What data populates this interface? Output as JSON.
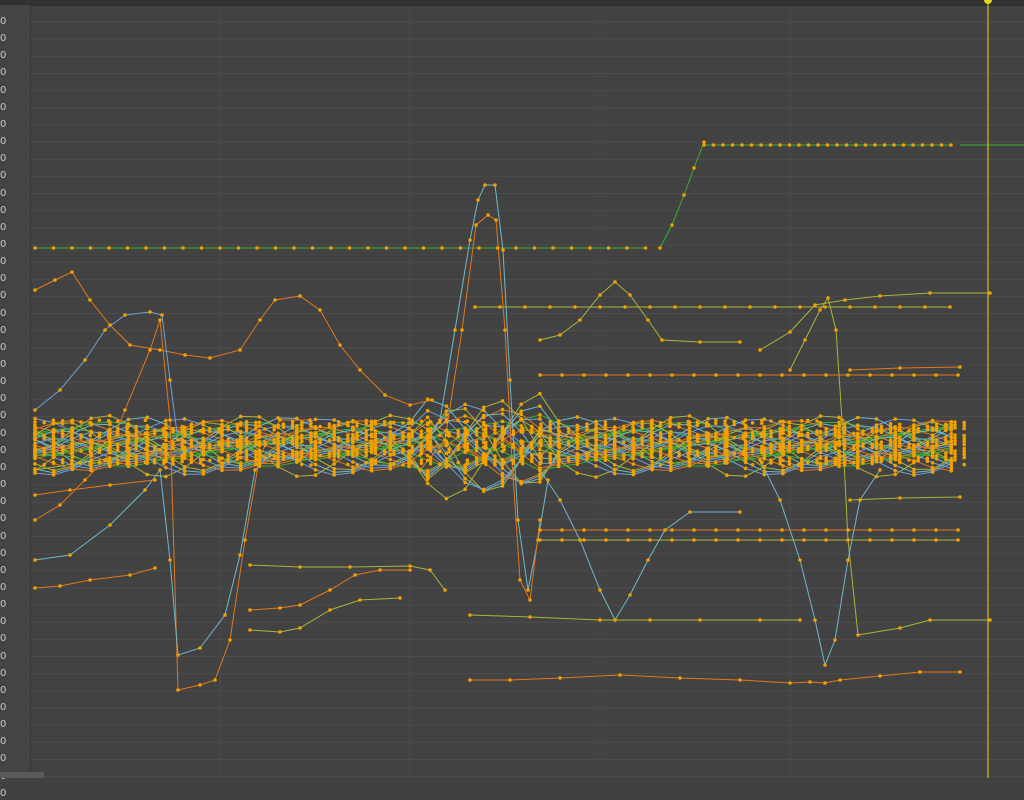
{
  "graph_editor": {
    "ruler": {
      "tick_labels": [
        "0",
        "0",
        "0",
        "0",
        "0",
        "0",
        "0",
        "0",
        "0",
        "0",
        "0",
        "0",
        "0",
        "0",
        "0",
        "0",
        "0",
        "0",
        "0",
        "0",
        "0",
        "0",
        "0",
        "0",
        "0",
        "0",
        "0",
        "0",
        "0",
        "0",
        "0",
        "0",
        "0",
        "0",
        "0",
        "0",
        "0",
        "0",
        "0",
        "0",
        "0",
        "0",
        "0",
        "0",
        "0",
        "0"
      ]
    },
    "playhead": {
      "has_handle": true,
      "color": "#e6d51d"
    },
    "colors": {
      "background": "#424242",
      "gridline": "#4c4c4c",
      "key_point": "#f0a000",
      "curve_green": "#38b030",
      "curve_orange": "#e0781e",
      "curve_blue": "#6e9fd8",
      "curve_yellowgreen": "#aab43a",
      "curve_cyan": "#6fb8c8"
    }
  }
}
